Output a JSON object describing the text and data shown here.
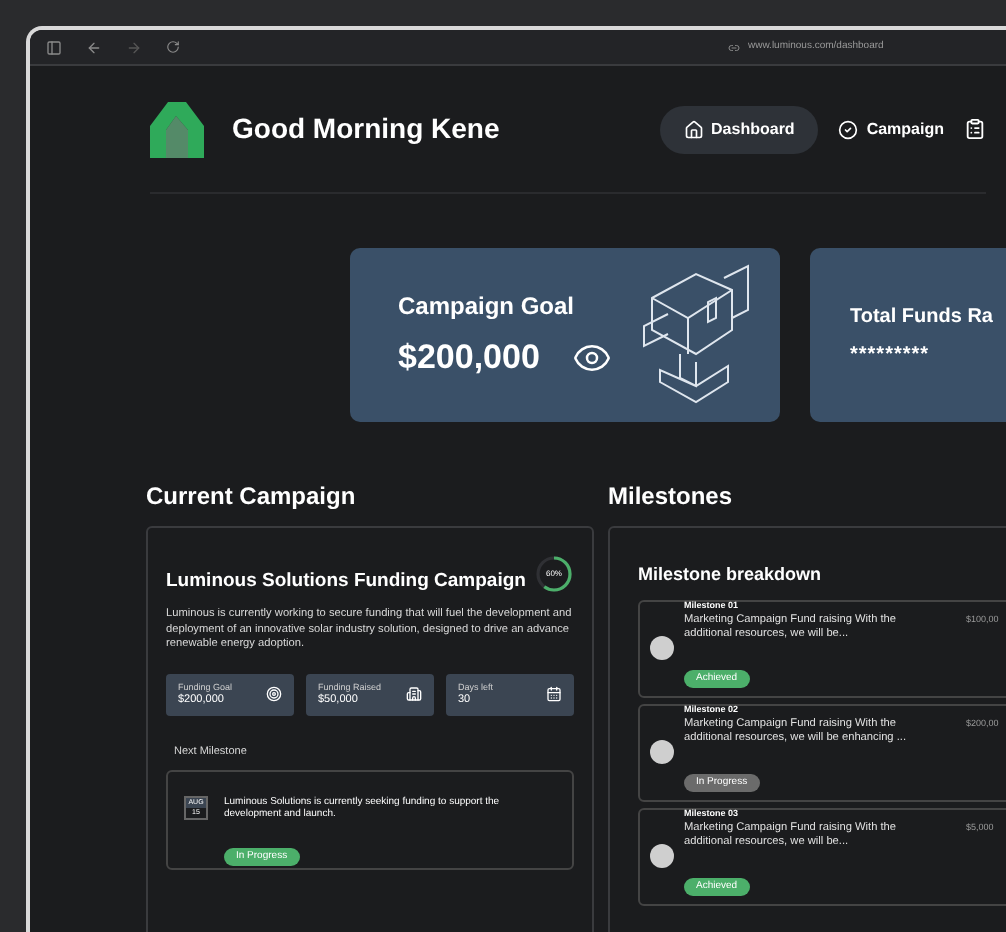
{
  "browser": {
    "url": "www.luminous.com/dashboard"
  },
  "header": {
    "greeting": "Good Morning Kene",
    "nav": [
      {
        "label": "Dashboard",
        "selected": true,
        "kind": "home"
      },
      {
        "label": "Campaign",
        "selected": false,
        "kind": "campaign"
      }
    ]
  },
  "cards": [
    {
      "title": "Campaign Goal",
      "value": "$200,000",
      "kind": "goal"
    },
    {
      "title": "Total Funds Ra",
      "value": "*********",
      "kind": "funds"
    }
  ],
  "current_campaign": {
    "heading": "Current Campaign",
    "title": "Luminous Solutions Funding Campaign",
    "progress": {
      "label": "60%",
      "level": 0.6
    },
    "description": "Luminous is currently working to secure funding that will fuel the development and deployment of an innovative solar industry solution, designed to drive an advance renewable energy adoption.",
    "stats": [
      {
        "label": "Funding Goal",
        "value": "$200,000",
        "kind": "target"
      },
      {
        "label": "Funding Raised",
        "value": "$50,000",
        "kind": "building"
      },
      {
        "label": "Days left",
        "value": "30",
        "kind": "calendar"
      }
    ],
    "next_milestone": {
      "heading": "Next Milestone",
      "month": "AUG",
      "day": "15",
      "text": "Luminous Solutions is currently seeking funding to support the development and launch.",
      "status": {
        "label": "In Progress",
        "color": "#4caf6a"
      }
    }
  },
  "milestones": {
    "heading": "Milestones",
    "title": "Milestone breakdown",
    "items": [
      {
        "name": "Milestone 01",
        "amount": "$100,00",
        "text": "Marketing Campaign Fund raising With the additional resources, we will be...",
        "status": {
          "label": "Achieved",
          "color": "#4caf6a"
        }
      },
      {
        "name": "Milestone 02",
        "amount": "$200,00",
        "text": "Marketing Campaign Fund raising With the additional resources, we will be enhancing ...",
        "status": {
          "label": "In Progress",
          "color": "#6b6b6b"
        }
      },
      {
        "name": "Milestone 03",
        "amount": "$5,000",
        "text": "Marketing Campaign Fund raising With the additional resources, we will be...",
        "status": {
          "label": "Achieved",
          "color": "#4caf6a"
        }
      }
    ]
  }
}
